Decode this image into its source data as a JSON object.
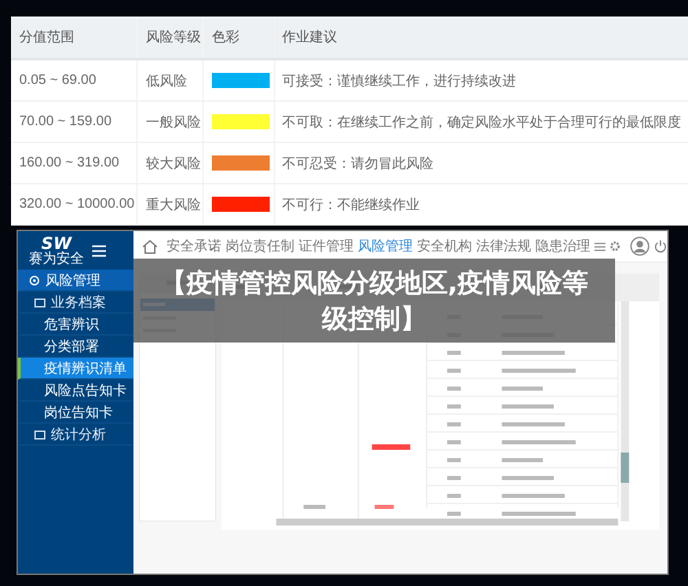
{
  "risk_table": {
    "columns": [
      "分值范围",
      "风险等级",
      "色彩",
      "作业建议"
    ],
    "rows": [
      {
        "range": "0.05 ~ 69.00",
        "level": "低风险",
        "color": "#00b0f0",
        "advice": "可接受：谨慎继续工作，进行持续改进"
      },
      {
        "range": "70.00 ~ 159.00",
        "level": "一般风险",
        "color": "#ffff33",
        "advice": "不可取：在继续工作之前，确定风险水平处于合理可行的最低限度"
      },
      {
        "range": "160.00 ~ 319.00",
        "level": "较大风险",
        "color": "#ed7d31",
        "advice": "不可忍受：请勿冒此风险"
      },
      {
        "range": "320.00 ~ 10000.00",
        "level": "重大风险",
        "color": "#ff2000",
        "advice": "不可行：不能继续作业"
      }
    ]
  },
  "embedded_screenshot": {
    "logo": {
      "mark": "SW",
      "name": "赛为安全"
    },
    "nav": [
      {
        "label": "安全承诺",
        "selected": false
      },
      {
        "label": "岗位责任制",
        "selected": false
      },
      {
        "label": "证件管理",
        "selected": false
      },
      {
        "label": "风险管理",
        "selected": true
      },
      {
        "label": "安全机构",
        "selected": false
      },
      {
        "label": "法律法规",
        "selected": false
      },
      {
        "label": "隐患治理",
        "selected": false
      }
    ],
    "sidebar": [
      {
        "label": "风险管理",
        "kind": "section",
        "selected": false
      },
      {
        "label": "业务档案",
        "kind": "group",
        "selected": false
      },
      {
        "label": "危害辨识",
        "kind": "item",
        "selected": false
      },
      {
        "label": "分类部署",
        "kind": "item",
        "selected": false
      },
      {
        "label": "疫情辨识清单",
        "kind": "item",
        "selected": true
      },
      {
        "label": "风险点告知卡",
        "kind": "item",
        "selected": false
      },
      {
        "label": "岗位告知卡",
        "kind": "item",
        "selected": false
      },
      {
        "label": "统计分析",
        "kind": "group",
        "selected": false
      }
    ]
  },
  "overlay_title": "【疫情管控风险分级地区,疫情风险等级控制】"
}
